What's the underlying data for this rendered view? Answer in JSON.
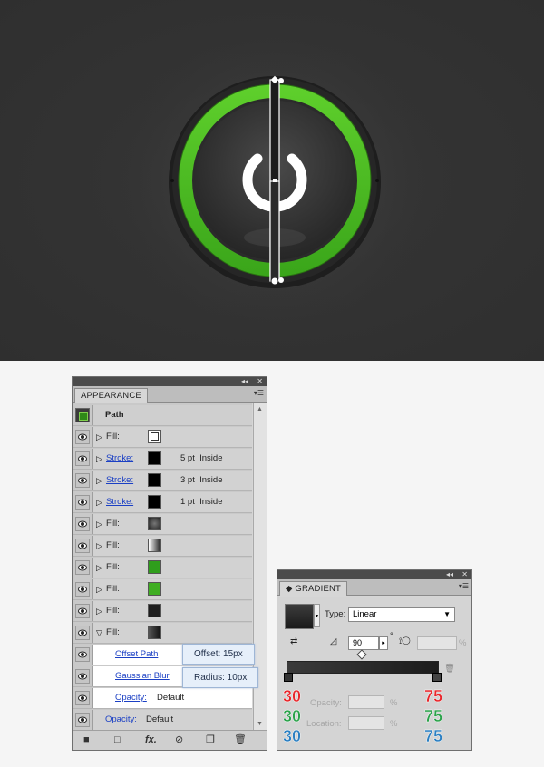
{
  "appearance": {
    "tab": "APPEARANCE",
    "path_label": "Path",
    "rows": [
      {
        "label": "Fill:",
        "link": false,
        "swatch": "#ffffff",
        "detail": ""
      },
      {
        "label": "Stroke:",
        "link": true,
        "swatch": "#000000",
        "detail": "5 pt  Inside"
      },
      {
        "label": "Stroke:",
        "link": true,
        "swatch": "#000000",
        "detail": "3 pt  Inside"
      },
      {
        "label": "Stroke:",
        "link": true,
        "swatch": "#000000",
        "detail": "1 pt  Inside"
      },
      {
        "label": "Fill:",
        "link": false,
        "swatch": "radial-dark",
        "detail": ""
      },
      {
        "label": "Fill:",
        "link": false,
        "swatch": "linear-white-black",
        "detail": ""
      },
      {
        "label": "Fill:",
        "link": false,
        "swatch": "#2f9e1c",
        "detail": ""
      },
      {
        "label": "Fill:",
        "link": false,
        "swatch": "#3fae22",
        "detail": ""
      },
      {
        "label": "Fill:",
        "link": false,
        "swatch": "#1e1e1e",
        "detail": ""
      },
      {
        "label": "Fill:",
        "link": false,
        "swatch": "linear-dark",
        "detail": ""
      }
    ],
    "effects": [
      {
        "label": "Offset Path",
        "tooltip": "Offset: 15px"
      },
      {
        "label": "Gaussian Blur",
        "tooltip": "Radius: 10px"
      }
    ],
    "sub_opacity": {
      "label": "Opacity:",
      "value": "Default"
    },
    "opacity": {
      "label": "Opacity:",
      "value": "Default"
    }
  },
  "gradient": {
    "tab": "GRADIENT",
    "type_label": "Type:",
    "type_value": "Linear",
    "angle": "90",
    "degree": "°",
    "opacity_label": "Opacity:",
    "location_label": "Location:",
    "percent": "%",
    "left_stop": {
      "r": "30",
      "g": "30",
      "b": "30"
    },
    "right_stop": {
      "r": "75",
      "g": "75",
      "b": "75"
    }
  },
  "colors": {
    "accent_green": "#44b81e",
    "canvas_bg": "#333333"
  }
}
